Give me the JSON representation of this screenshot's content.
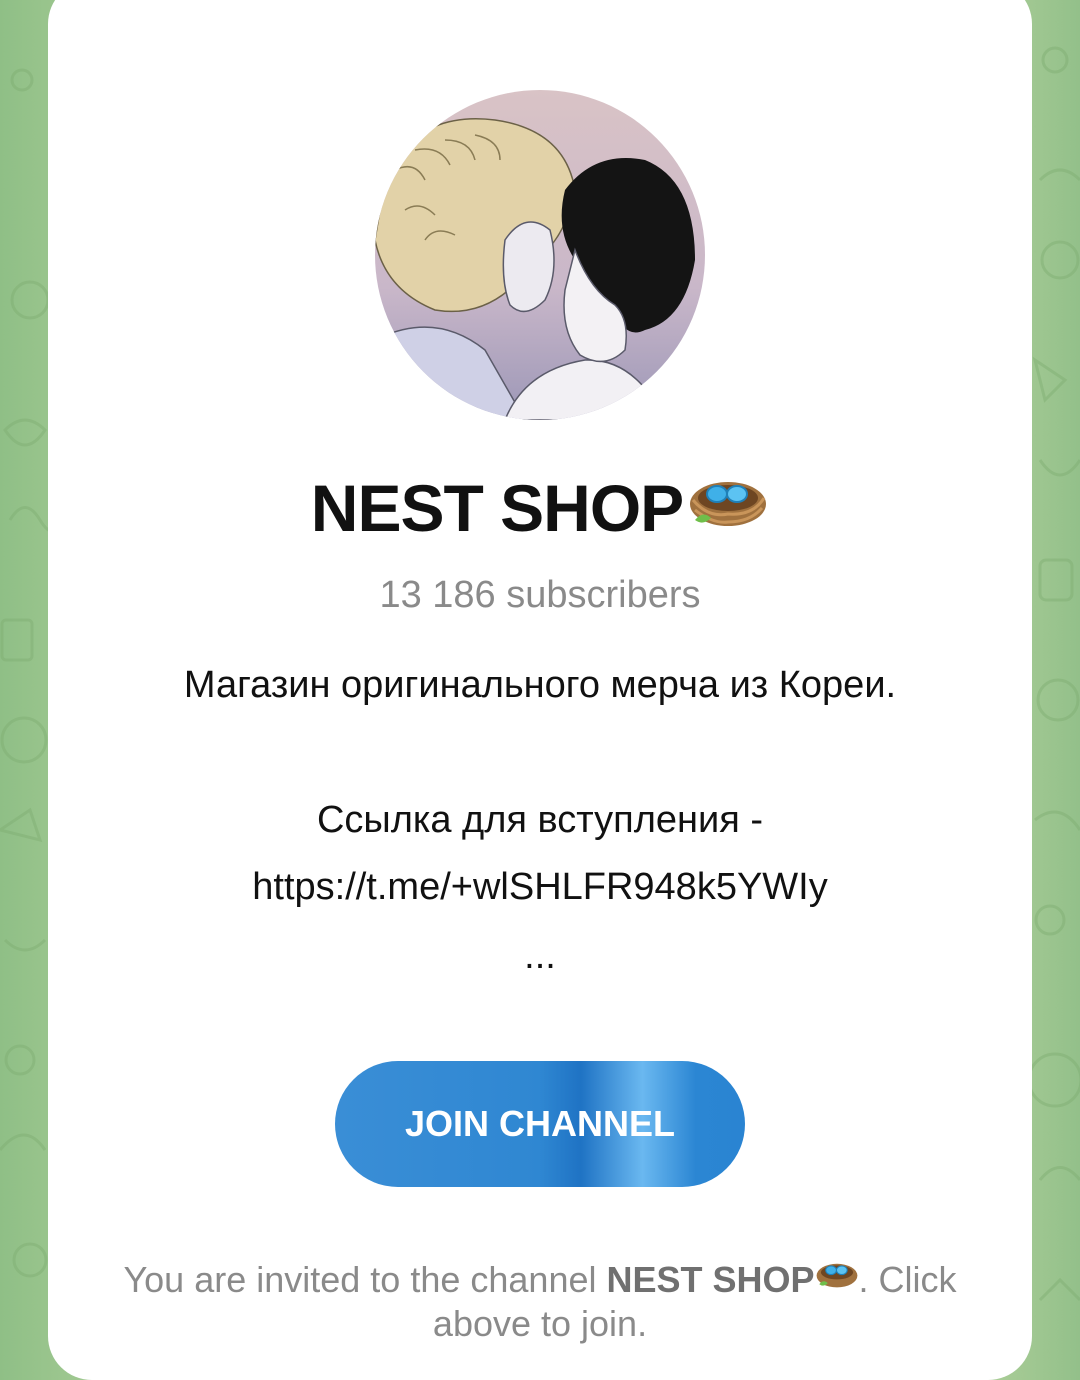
{
  "channel": {
    "name": "NEST SHOP",
    "name_emoji": "nest-with-eggs-emoji",
    "subscribers": "13 186 subscribers",
    "description_line1": "Магазин оригинального мерча из Кореи.",
    "description_line2": "Ссылка для вступления -",
    "description_line3": "https://t.me/+wlSHLFR948k5YWIy",
    "description_more": "..."
  },
  "join_button": {
    "label": "JOIN CHANNEL"
  },
  "footer": {
    "prefix": "You are invited to the channel ",
    "channel_name": "NEST SHOP",
    "suffix_line1": ". Click",
    "line2": "above to join."
  },
  "colors": {
    "button_blue": "#2f87d2",
    "background_green": "#a9cd97",
    "muted_text": "#8a8a8a"
  }
}
